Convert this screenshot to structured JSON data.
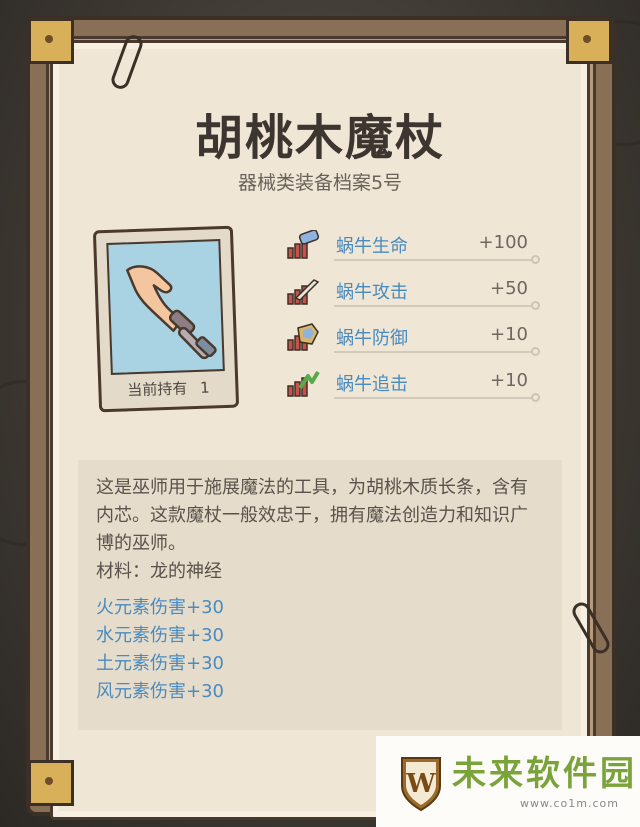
{
  "item": {
    "title": "胡桃木魔杖",
    "subtitle": "器械类装备档案5号",
    "holding_label": "当前持有",
    "holding_count": "1"
  },
  "stats": [
    {
      "name": "蜗牛生命",
      "value": "+100",
      "icon": "life-potion-icon"
    },
    {
      "name": "蜗牛攻击",
      "value": "+50",
      "icon": "attack-sword-icon"
    },
    {
      "name": "蜗牛防御",
      "value": "+10",
      "icon": "defense-shield-icon"
    },
    {
      "name": "蜗牛追击",
      "value": "+10",
      "icon": "pursuit-arrow-icon"
    }
  ],
  "description": {
    "text": "这是巫师用于施展魔法的工具，为胡桃木质长条，含有内芯。这款魔杖一般效忠于，拥有魔法创造力和知识广博的巫师。",
    "material": "材料：龙的神经",
    "bonuses": [
      "火元素伤害+30",
      "水元素伤害+30",
      "土元素伤害+30",
      "风元素伤害+30"
    ]
  },
  "watermark": {
    "main": "未来软件园",
    "sub": "www.co1m.com",
    "logo_letter": "W"
  },
  "colors": {
    "stat_name": "#4a8bbf",
    "bonus": "#4a8bbf",
    "paper": "#efe6d5",
    "watermark": "#7aa33a"
  }
}
